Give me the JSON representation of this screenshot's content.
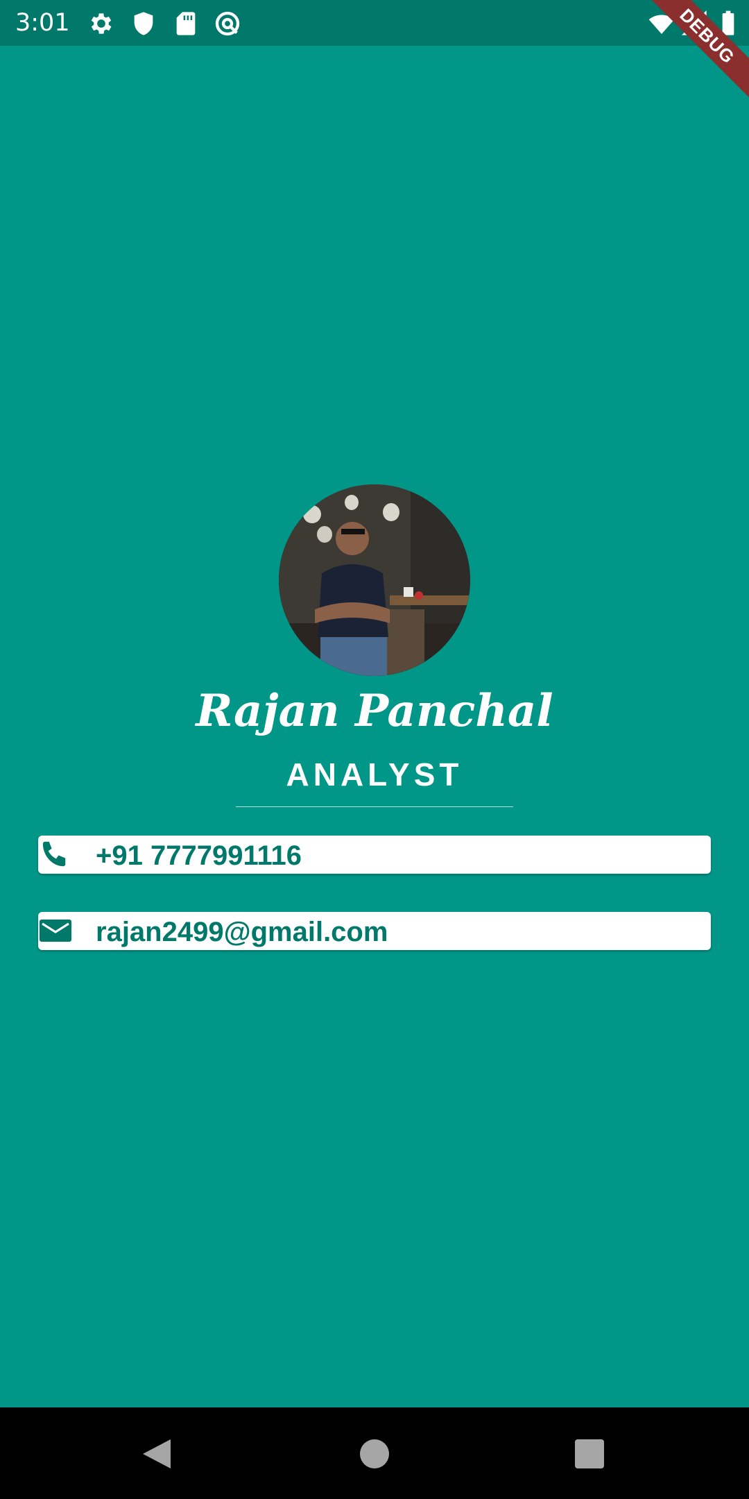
{
  "status_bar": {
    "time": "3:01",
    "left_icons": [
      "gear-icon",
      "shield-icon",
      "sd-card-icon",
      "at-sign-icon"
    ],
    "right_icons": [
      "wifi-icon",
      "signal-icon",
      "battery-icon"
    ],
    "debug_banner": "DEBUG"
  },
  "profile": {
    "name": "Rajan Panchal",
    "title": "ANALYST"
  },
  "contacts": {
    "phone": {
      "icon": "phone-icon",
      "value": "+91 7777991116"
    },
    "email": {
      "icon": "mail-icon",
      "value": "rajan2499@gmail.com"
    }
  },
  "navigation": {
    "buttons": [
      "back-button",
      "home-button",
      "recents-button"
    ]
  },
  "colors": {
    "background": "#009688",
    "status_bar": "#00796B",
    "card": "#FFFFFF",
    "accent_text": "#00796B",
    "debug_banner": "#8B2E2E"
  }
}
